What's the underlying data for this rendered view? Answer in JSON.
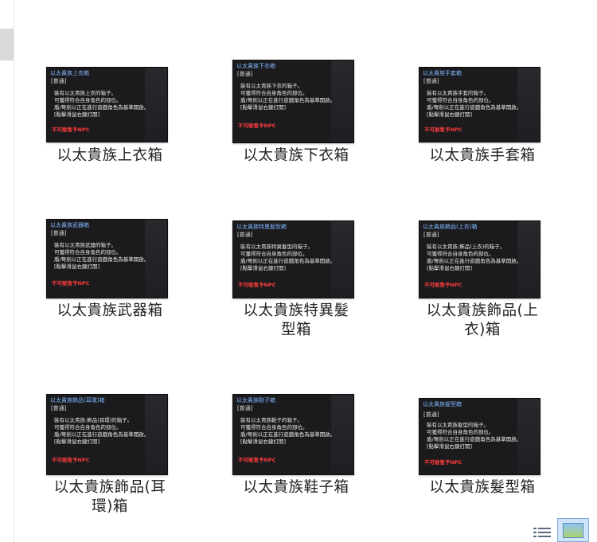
{
  "items": [
    {
      "label_line1": "以太貴族上衣箱",
      "label_line2": "",
      "tooltip_title": "以太貴族上衣箱",
      "tooltip_desc": "裝有以太貴族上衣的箱子。\n可獲得符合自身角色的部位。\n盾/弩劍以正在進行遊戲角色為基準開啟。\n[點擊滑鼠右鍵打開]"
    },
    {
      "label_line1": "以太貴族下衣箱",
      "label_line2": "",
      "tooltip_title": "以太貴族下衣箱",
      "tooltip_desc": "裝有以太貴族下衣的箱子。\n可獲得符合自身角色的部位。\n盾/弩劍以正在進行遊戲角色為基準開啟。\n[點擊滑鼠右鍵打開]"
    },
    {
      "label_line1": "以太貴族手套箱",
      "label_line2": "",
      "tooltip_title": "以太貴族手套箱",
      "tooltip_desc": "裝有以太貴族手套的箱子。\n可獲得符合自身角色的部位。\n盾/弩劍以正在進行遊戲角色為基準開啟。\n[點擊滑鼠右鍵打開]"
    },
    {
      "label_line1": "以太貴族武器箱",
      "label_line2": "",
      "tooltip_title": "以太貴族武器箱",
      "tooltip_desc": "裝有以太貴族武器的箱子。\n可獲得符合自身角色的部位。\n盾/弩劍以正在進行遊戲角色為基準開啟。\n[點擊滑鼠右鍵打開]"
    },
    {
      "label_line1": "以太貴族特異髮",
      "label_line2": "型箱",
      "tooltip_title": "以太貴族特異髮型箱",
      "tooltip_desc": "裝有以太貴族特異髮型的箱子。\n可獲得符合自身角色的部位。\n盾/弩劍以正在進行遊戲角色為基準開啟。\n[點擊滑鼠右鍵打開]"
    },
    {
      "label_line1": "以太貴族飾品(上",
      "label_line2": "衣)箱",
      "tooltip_title": "以太貴族飾品(上衣)箱",
      "tooltip_desc": "裝有以太貴族:飾品(上衣)的箱子。\n可獲得符合自身角色的部位。\n盾/弩劍以正在進行遊戲角色為基準開啟。\n[點擊滑鼠右鍵打開]"
    },
    {
      "label_line1": "以太貴族飾品(耳",
      "label_line2": "環)箱",
      "tooltip_title": "以太貴族飾品(耳環)箱",
      "tooltip_desc": "裝有以太貴族:飾品(耳環)的箱子。\n可獲得符合自身角色的部位。\n盾/弩劍以正在進行遊戲角色為基準開啟。\n[點擊滑鼠右鍵打開]"
    },
    {
      "label_line1": "以太貴族鞋子箱",
      "label_line2": "",
      "tooltip_title": "以太貴族鞋子箱",
      "tooltip_desc": "裝有以太貴族鞋子的箱子。\n可獲得符合自身角色的部位。\n盾/弩劍以正在進行遊戲角色為基準開啟。\n[點擊滑鼠右鍵打開]"
    },
    {
      "label_line1": "以太貴族髮型箱",
      "label_line2": "",
      "tooltip_title": "以太貴族髮型箱",
      "tooltip_desc": "裝有以太貴族髮型的箱子。\n可獲得符合自身角色的部位。\n盾/弩劍以正在進行遊戲角色為基準開啟。\n[點擊滑鼠右鍵打開]"
    }
  ],
  "tooltip_common": {
    "grade": "[普通]",
    "warning": "不可販售予NPC"
  },
  "colors": {
    "tooltip_bg": "#1b1b1d",
    "tooltip_title": "#7fb7ff",
    "warning": "#ff3a3a",
    "label_text": "#222222"
  },
  "view_icons": {
    "details": "details-view-icon",
    "large": "large-icons-view-icon"
  }
}
